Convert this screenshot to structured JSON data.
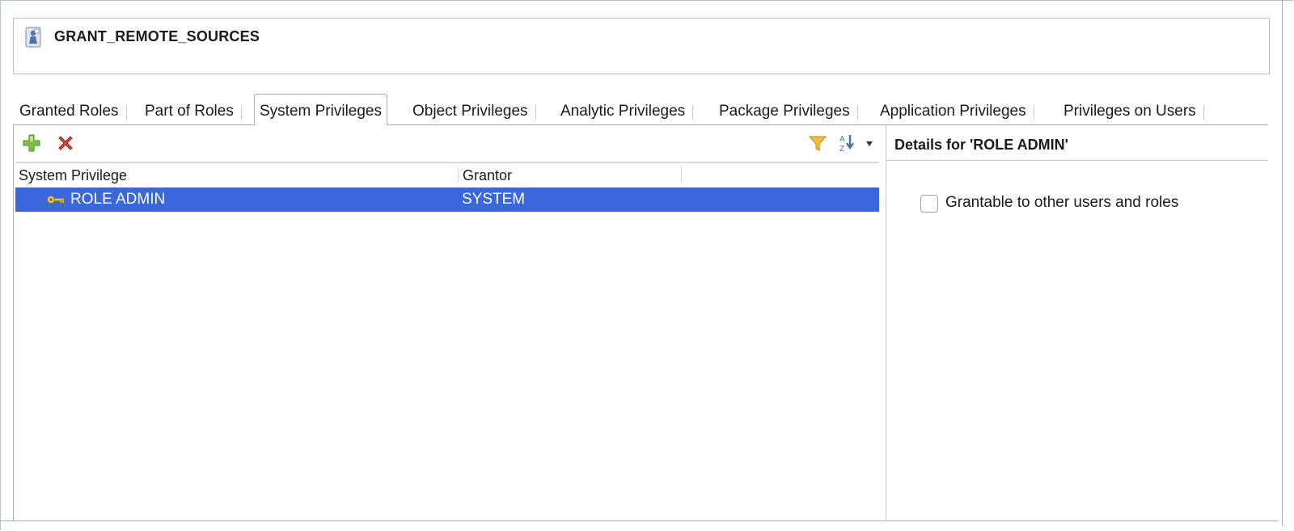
{
  "header": {
    "title": "GRANT_REMOTE_SOURCES",
    "icon": "role-icon"
  },
  "tabs": [
    {
      "label": "Granted Roles"
    },
    {
      "label": "Part of Roles"
    },
    {
      "label": "System Privileges",
      "active": true
    },
    {
      "label": "Object Privileges"
    },
    {
      "label": "Analytic Privileges"
    },
    {
      "label": "Package Privileges"
    },
    {
      "label": "Application Privileges"
    },
    {
      "label": "Privileges on Users"
    }
  ],
  "toolbar": {
    "add_icon": "add-icon",
    "delete_icon": "delete-icon",
    "filter_icon": "filter-icon",
    "sort_icon": "sort-az-icon"
  },
  "table": {
    "columns": [
      "System Privilege",
      "Grantor"
    ],
    "rows": [
      {
        "privilege": "ROLE ADMIN",
        "grantor": "SYSTEM",
        "selected": true
      }
    ]
  },
  "details": {
    "title": "Details for 'ROLE ADMIN'",
    "grantable_label": "Grantable to other users and roles",
    "grantable_checked": false
  },
  "colors": {
    "selection": "#3b67dc",
    "border": "#a6abb3"
  }
}
